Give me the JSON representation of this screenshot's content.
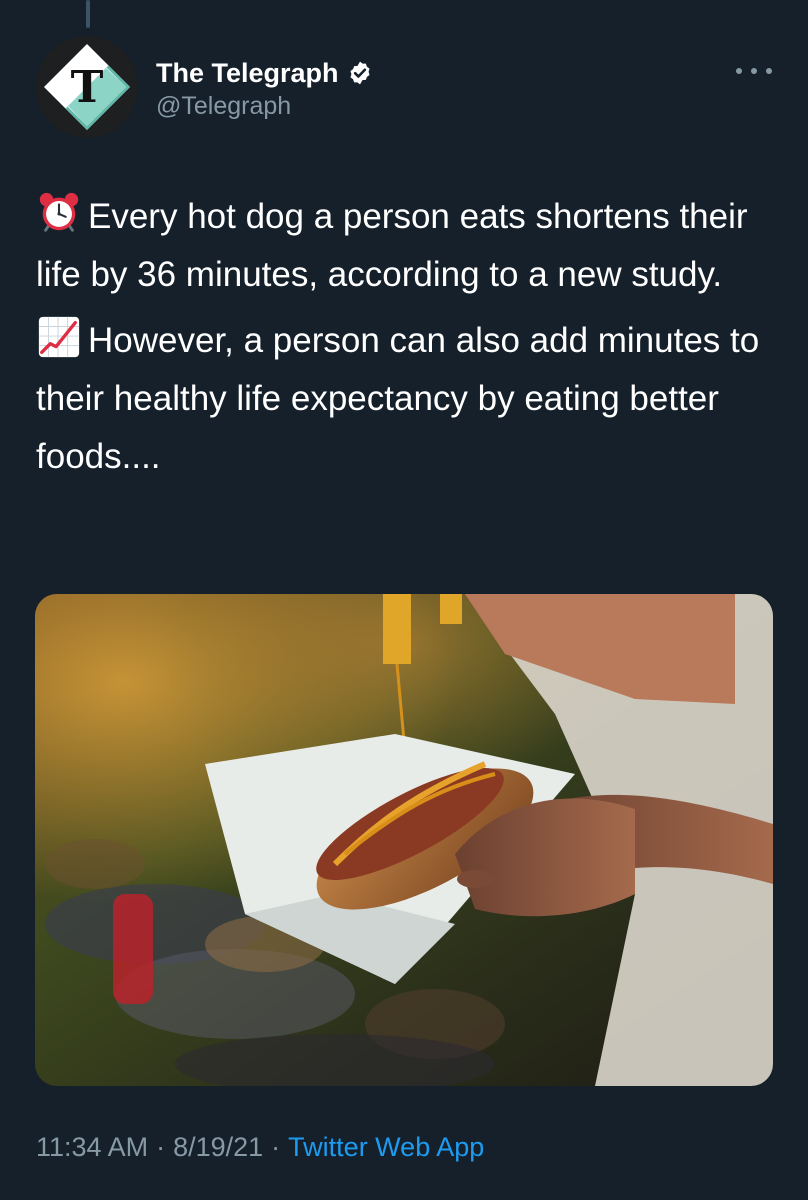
{
  "tweet": {
    "author": {
      "display_name": "The Telegraph",
      "handle": "@Telegraph",
      "verified": true,
      "avatar_icon": "telegraph-t-logo"
    },
    "text": {
      "para1_emoji": "alarm-clock-icon",
      "para1": "Every hot dog a person eats shortens their life by 36 minutes, according to a new study.",
      "para2_emoji": "chart-increasing-icon",
      "para2": "However, a person can also add minutes to their healthy life expectancy by eating better foods...."
    },
    "media": {
      "type": "photo",
      "description_icon": "hot-dog-photo"
    },
    "meta": {
      "time": "11:34 AM",
      "date": "8/19/21",
      "separator": "·",
      "source": "Twitter Web App"
    }
  },
  "colors": {
    "background": "#15202b",
    "text_primary": "#ffffff",
    "text_secondary": "#8899a6",
    "link": "#1d9bf0",
    "verified_badge": "#ffffff"
  }
}
